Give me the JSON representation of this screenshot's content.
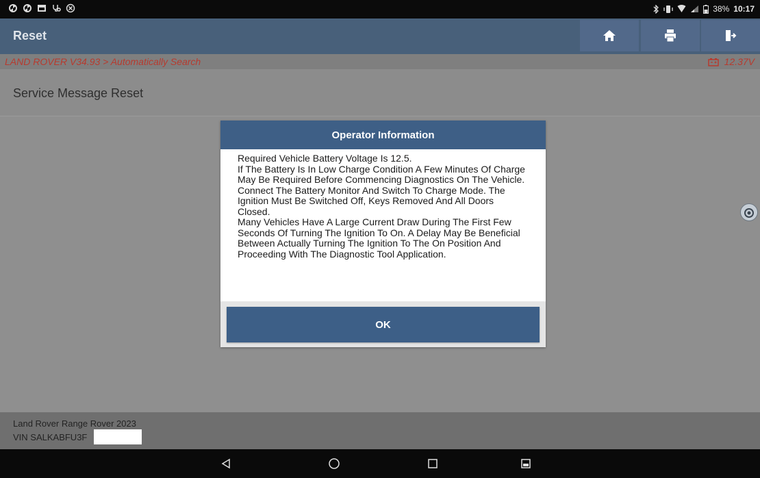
{
  "status_bar": {
    "battery": "38%",
    "time": "10:17"
  },
  "title_bar": {
    "title": "Reset",
    "buttons": [
      "home-icon",
      "print-icon",
      "exit-icon"
    ]
  },
  "breadcrumb": {
    "path": "LAND ROVER V34.93 > Automatically Search",
    "voltage": "12.37V"
  },
  "page": {
    "heading": "Service Message Reset"
  },
  "dialog": {
    "title": "Operator Information",
    "message": "Required Vehicle Battery Voltage Is 12.5.\nIf The Battery Is In Low Charge Condition A Few Minutes Of Charge May Be Required Before Commencing Diagnostics On The Vehicle.  Connect The Battery Monitor And Switch To Charge Mode.  The Ignition Must Be Switched Off, Keys Removed And All Doors Closed.\nMany Vehicles Have A Large Current Draw During The First Few Seconds Of Turning The Ignition To On.  A Delay May Be Beneficial Between Actually Turning The Ignition To The On Position And Proceeding With The Diagnostic Tool Application.",
    "ok_label": "OK"
  },
  "footer": {
    "vehicle": "Land Rover Range Rover 2023",
    "vin": "VIN SALKABFU3F"
  },
  "colors": {
    "title_bar": "#48607a",
    "dialog_header": "#3e5f86",
    "ok_button": "#3d5f87",
    "breadcrumb_text": "#b73a2e"
  }
}
